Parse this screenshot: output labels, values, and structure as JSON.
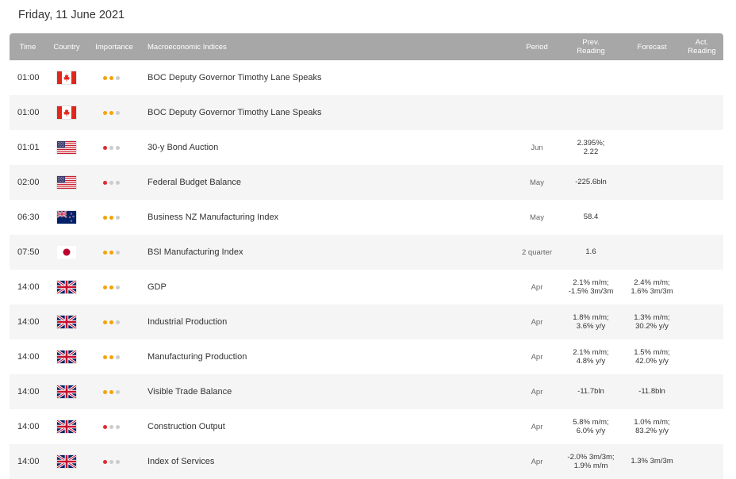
{
  "page": {
    "date_heading": "Friday, 11 June 2021"
  },
  "colors": {
    "header_bg": "#a7a7a7",
    "high": "#e3282d",
    "medium": "#f5a200",
    "inactive": "#cccccc"
  },
  "headers": {
    "time": "Time",
    "country": "Country",
    "importance": "Importance",
    "indices": "Macroeconomic Indices",
    "period": "Period",
    "prev": "Prev.\nReading",
    "forecast": "Forecast",
    "actual": "Act.\nReading"
  },
  "events": [
    {
      "time": "01:00",
      "country": "canada-flag-icon",
      "importance": "medium",
      "name": "BOC Deputy Governor Timothy Lane Speaks",
      "period": "",
      "prev": "",
      "forecast": "",
      "actual": ""
    },
    {
      "time": "01:00",
      "country": "canada-flag-icon",
      "importance": "medium",
      "name": "BOC Deputy Governor Timothy Lane Speaks",
      "period": "",
      "prev": "",
      "forecast": "",
      "actual": ""
    },
    {
      "time": "01:01",
      "country": "us-flag-icon",
      "importance": "high",
      "name": "30-y Bond Auction",
      "period": "Jun",
      "prev": "2.395%;\n2.22",
      "forecast": "",
      "actual": ""
    },
    {
      "time": "02:00",
      "country": "us-flag-icon",
      "importance": "high",
      "name": "Federal Budget Balance",
      "period": "May",
      "prev": "-225.6bln",
      "forecast": "",
      "actual": ""
    },
    {
      "time": "06:30",
      "country": "new-zealand-flag-icon",
      "importance": "medium",
      "name": "Business NZ Manufacturing Index",
      "period": "May",
      "prev": "58.4",
      "forecast": "",
      "actual": ""
    },
    {
      "time": "07:50",
      "country": "japan-flag-icon",
      "importance": "medium",
      "name": "BSI Manufacturing Index",
      "period": "2 quarter",
      "prev": "1.6",
      "forecast": "",
      "actual": ""
    },
    {
      "time": "14:00",
      "country": "uk-flag-icon",
      "importance": "medium",
      "name": "GDP",
      "period": "Apr",
      "prev": "2.1% m/m;\n-1.5% 3m/3m",
      "forecast": "2.4% m/m;\n1.6% 3m/3m",
      "actual": ""
    },
    {
      "time": "14:00",
      "country": "uk-flag-icon",
      "importance": "medium",
      "name": "Industrial Production",
      "period": "Apr",
      "prev": "1.8% m/m;\n3.6% y/y",
      "forecast": "1.3% m/m;\n30.2% y/y",
      "actual": ""
    },
    {
      "time": "14:00",
      "country": "uk-flag-icon",
      "importance": "medium",
      "name": "Manufacturing Production",
      "period": "Apr",
      "prev": "2.1% m/m;\n4.8% y/y",
      "forecast": "1.5% m/m;\n42.0% y/y",
      "actual": ""
    },
    {
      "time": "14:00",
      "country": "uk-flag-icon",
      "importance": "medium",
      "name": "Visible Trade Balance",
      "period": "Apr",
      "prev": "-11.7bln",
      "forecast": "-11.8bln",
      "actual": ""
    },
    {
      "time": "14:00",
      "country": "uk-flag-icon",
      "importance": "high",
      "name": "Construction Output",
      "period": "Apr",
      "prev": "5.8% m/m;\n6.0% y/y",
      "forecast": "1.0% m/m;\n83.2% y/y",
      "actual": ""
    },
    {
      "time": "14:00",
      "country": "uk-flag-icon",
      "importance": "high",
      "name": "Index of Services",
      "period": "Apr",
      "prev": "-2.0% 3m/3m;\n1.9% m/m",
      "forecast": "1.3% 3m/3m",
      "actual": ""
    }
  ]
}
